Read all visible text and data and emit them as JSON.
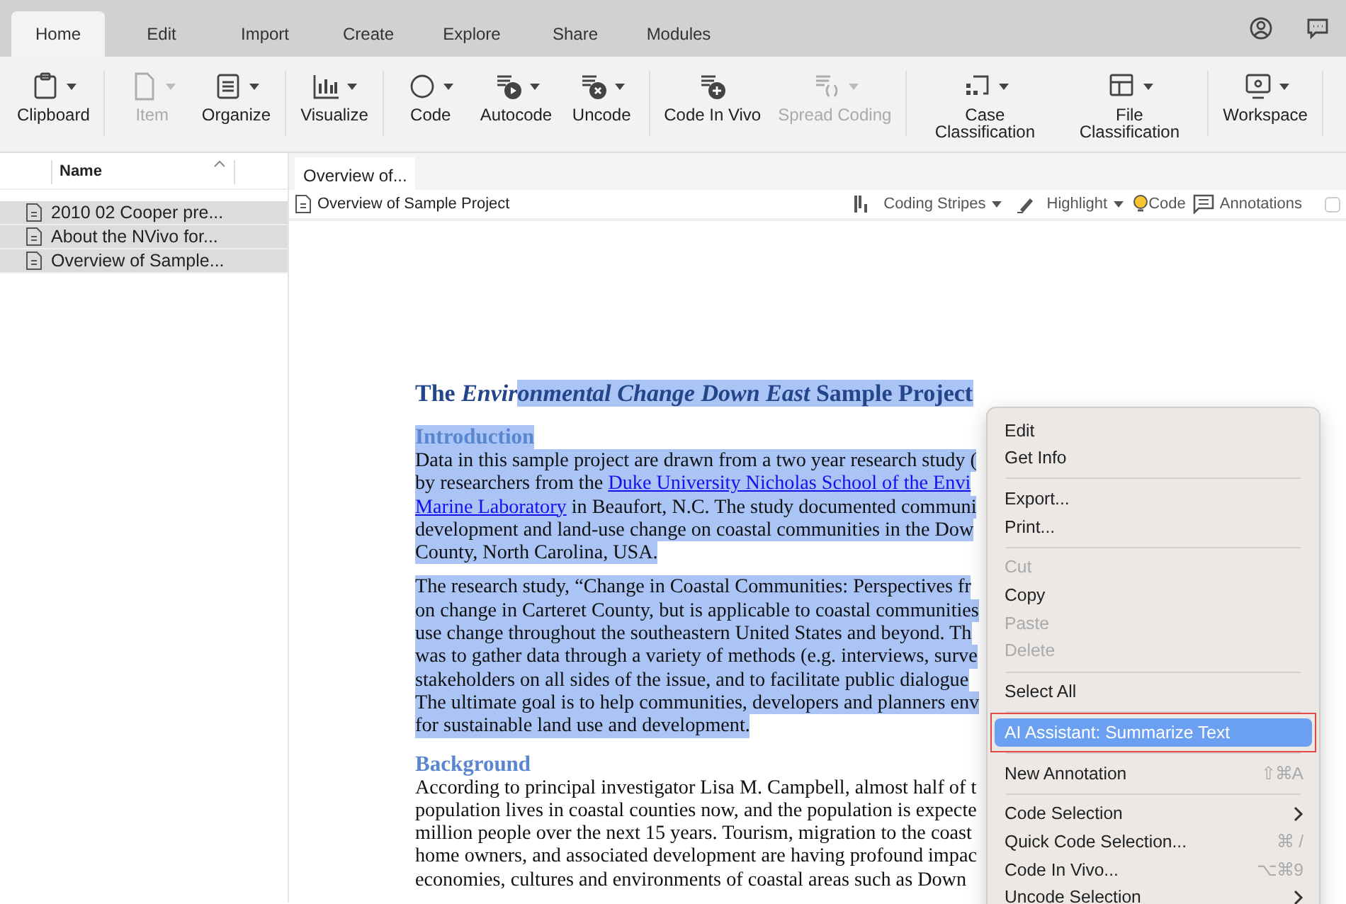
{
  "tabs": [
    {
      "label": "Home",
      "selected": true
    },
    {
      "label": "Edit",
      "selected": false
    },
    {
      "label": "Import",
      "selected": false
    },
    {
      "label": "Create",
      "selected": false
    },
    {
      "label": "Explore",
      "selected": false
    },
    {
      "label": "Share",
      "selected": false
    },
    {
      "label": "Modules",
      "selected": false
    }
  ],
  "ribbon": [
    [
      {
        "label": "Clipboard",
        "disabled": false,
        "dropdown": true
      }
    ],
    [
      {
        "label": "Item",
        "disabled": true,
        "dropdown": true
      },
      {
        "label": "Organize",
        "disabled": false,
        "dropdown": true
      }
    ],
    [
      {
        "label": "Visualize",
        "disabled": false,
        "dropdown": true
      }
    ],
    [
      {
        "label": "Code",
        "disabled": false,
        "dropdown": true
      },
      {
        "label": "Autocode",
        "disabled": false,
        "dropdown": true
      },
      {
        "label": "Uncode",
        "disabled": false,
        "dropdown": true
      }
    ],
    [
      {
        "label": "Code In Vivo",
        "disabled": false,
        "dropdown": false
      },
      {
        "label": "Spread Coding",
        "disabled": true,
        "dropdown": true
      }
    ],
    [
      {
        "label": "Case Classification",
        "disabled": false,
        "dropdown": true
      },
      {
        "label": "File Classification",
        "disabled": false,
        "dropdown": true
      }
    ],
    [
      {
        "label": "Workspace",
        "disabled": false,
        "dropdown": true
      }
    ]
  ],
  "sidebar": {
    "column": "Name",
    "items": [
      {
        "label": "2010 02 Cooper pre...",
        "selected": true
      },
      {
        "label": "About the NVivo for...",
        "selected": true
      },
      {
        "label": "Overview of Sample...",
        "selected": true
      }
    ]
  },
  "document_tab": "Overview of...",
  "document_toolbar": {
    "title": "Overview of Sample Project",
    "coding_stripes": "Coding Stripes",
    "highlight": "Highlight",
    "code": "Code",
    "annotations": "Annotations",
    "checked": false
  },
  "document": {
    "title": [
      {
        "text": "The ",
        "italic": false,
        "selected": false
      },
      {
        "text": "Envir",
        "italic": true,
        "selected": false
      },
      {
        "text": "onmental Change Down East",
        "italic": true,
        "selected": true
      },
      {
        "text": " Sample Project",
        "italic": false,
        "selected": true
      }
    ],
    "sections": [
      {
        "heading": "Introduction",
        "selected": true,
        "paragraphs": [
          {
            "selected": true,
            "lines": [
              [
                {
                  "text": "Data in this sample project are drawn from a two year research study ("
                }
              ],
              [
                {
                  "text": "by researchers from the "
                },
                {
                  "text": "Duke University Nicholas School of the Envi",
                  "link": true
                }
              ],
              [
                {
                  "text": "Marine Laboratory",
                  "link": true
                },
                {
                  "text": " in Beaufort, N.C. The study documented communi"
                }
              ],
              [
                {
                  "text": "development and land-use change on coastal communities in the Dow"
                }
              ],
              [
                {
                  "text": "County, North Carolina, USA."
                }
              ]
            ]
          },
          {
            "selected": true,
            "lines": [
              [
                {
                  "text": "The research study, “Change in Coastal Communities: Perspectives fr"
                }
              ],
              [
                {
                  "text": "on change in Carteret County, but is applicable to coastal communities"
                }
              ],
              [
                {
                  "text": "use change throughout the southeastern United States and beyond. Th"
                }
              ],
              [
                {
                  "text": "was to gather data through a variety of methods (e.g. interviews, surve"
                }
              ],
              [
                {
                  "text": "stakeholders on all sides of the issue, and to facilitate public dialogue"
                }
              ],
              [
                {
                  "text": "The ultimate goal is to help communities, developers and planners env"
                }
              ],
              [
                {
                  "text": "for sustainable land use and development."
                }
              ]
            ]
          }
        ]
      },
      {
        "heading": "Background",
        "selected": false,
        "paragraphs": [
          {
            "selected": false,
            "lines": [
              [
                {
                  "text": "According to principal investigator Lisa M. Campbell, almost half of t"
                }
              ],
              [
                {
                  "text": "population lives in coastal counties now, and the population is expecte"
                }
              ],
              [
                {
                  "text": "million people over the next 15 years. Tourism, migration to the coast"
                }
              ],
              [
                {
                  "text": "home owners, and associated development are having profound impac"
                }
              ],
              [
                {
                  "text": "economies, cultures and environments of coastal areas such as Down"
                }
              ]
            ]
          }
        ]
      }
    ]
  },
  "context_menu": [
    {
      "kind": "item",
      "label": "Edit",
      "disabled": false,
      "selected": false,
      "submenu": false
    },
    {
      "kind": "item",
      "label": "Get Info",
      "disabled": false,
      "selected": false,
      "submenu": false
    },
    {
      "kind": "separator"
    },
    {
      "kind": "item",
      "label": "Export...",
      "disabled": false,
      "selected": false,
      "submenu": false
    },
    {
      "kind": "item",
      "label": "Print...",
      "disabled": false,
      "selected": false,
      "submenu": false
    },
    {
      "kind": "separator"
    },
    {
      "kind": "item",
      "label": "Cut",
      "disabled": true,
      "selected": false,
      "submenu": false
    },
    {
      "kind": "item",
      "label": "Copy",
      "disabled": false,
      "selected": false,
      "submenu": false
    },
    {
      "kind": "item",
      "label": "Paste",
      "disabled": true,
      "selected": false,
      "submenu": false
    },
    {
      "kind": "item",
      "label": "Delete",
      "disabled": true,
      "selected": false,
      "submenu": false
    },
    {
      "kind": "separator"
    },
    {
      "kind": "item",
      "label": "Select All",
      "disabled": false,
      "selected": false,
      "submenu": false
    },
    {
      "kind": "separator"
    },
    {
      "kind": "item",
      "label": "AI Assistant: Summarize Text",
      "disabled": false,
      "selected": true,
      "submenu": false,
      "outlined": true
    },
    {
      "kind": "separator"
    },
    {
      "kind": "item",
      "label": "New Annotation",
      "disabled": false,
      "selected": false,
      "submenu": false,
      "shortcut": "⇧⌘A"
    },
    {
      "kind": "separator"
    },
    {
      "kind": "item",
      "label": "Code Selection",
      "disabled": false,
      "selected": false,
      "submenu": true
    },
    {
      "kind": "item",
      "label": "Quick Code Selection...",
      "disabled": false,
      "selected": false,
      "submenu": false,
      "shortcut": "⌘ /"
    },
    {
      "kind": "item",
      "label": "Code In Vivo...",
      "disabled": false,
      "selected": false,
      "submenu": false,
      "shortcut": "⌥⌘9"
    },
    {
      "kind": "item",
      "label": "Uncode Selection",
      "disabled": false,
      "selected": false,
      "submenu": true
    }
  ]
}
